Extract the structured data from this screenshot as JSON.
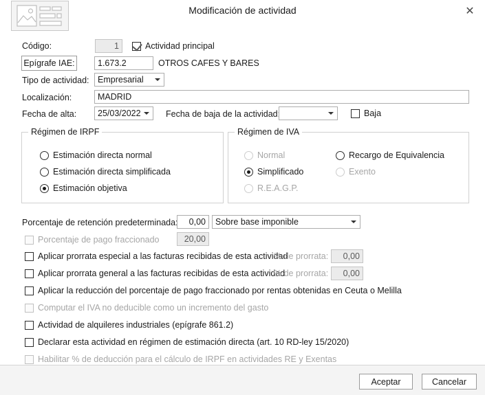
{
  "window": {
    "title": "Modificación de actividad",
    "close_label": "✕",
    "icon_name": "image-form-icon"
  },
  "form": {
    "codigo_label": "Código:",
    "codigo_value": "1",
    "actividad_principal_label": "Actividad principal",
    "actividad_principal_checked": true,
    "epigrafe_button_label": "Epígrafe IAE:",
    "epigrafe_value": "1.673.2",
    "epigrafe_description": "OTROS CAFES Y BARES",
    "tipo_actividad_label": "Tipo de actividad:",
    "tipo_actividad_value": "Empresarial",
    "localizacion_label": "Localización:",
    "localizacion_value": "MADRID",
    "fecha_alta_label": "Fecha de alta:",
    "fecha_alta_value": "25/03/2022",
    "fecha_baja_label": "Fecha de baja de la actividad:",
    "fecha_baja_value": "",
    "baja_label": "Baja",
    "baja_checked": false
  },
  "irpf": {
    "title": "Régimen de IRPF",
    "options": [
      {
        "label": "Estimación directa normal",
        "selected": false,
        "disabled": false
      },
      {
        "label": "Estimación directa simplificada",
        "selected": false,
        "disabled": false
      },
      {
        "label": "Estimación objetiva",
        "selected": true,
        "disabled": false
      }
    ]
  },
  "iva": {
    "title": "Régimen de IVA",
    "options_left": [
      {
        "label": "Normal",
        "selected": false,
        "disabled": true
      },
      {
        "label": "Simplificado",
        "selected": true,
        "disabled": false
      },
      {
        "label": "R.E.A.G.P.",
        "selected": false,
        "disabled": true
      }
    ],
    "options_right": [
      {
        "label": "Recargo de Equivalencia",
        "selected": false,
        "disabled": false
      },
      {
        "label": "Exento",
        "selected": false,
        "disabled": true
      }
    ]
  },
  "percentages": {
    "retencion_label": "Porcentaje de retención predeterminada:",
    "retencion_value": "0,00",
    "retencion_base_value": "Sobre base imponible",
    "pago_fraccionado_label": "Porcentaje de pago fraccionado",
    "pago_fraccionado_checked": false,
    "pago_fraccionado_disabled": true,
    "pago_fraccionado_value": "20,00"
  },
  "options": [
    {
      "label": "Aplicar prorrata especial a las facturas recibidas de esta actividad",
      "checked": false,
      "disabled": false,
      "extra_label": "% de prorrata:",
      "extra_value": "0,00"
    },
    {
      "label": "Aplicar prorrata general a las facturas recibidas de esta actividad",
      "checked": false,
      "disabled": false,
      "extra_label": "% de prorrata:",
      "extra_value": "0,00"
    },
    {
      "label": "Aplicar la reducción del porcentaje de pago fraccionado por rentas obtenidas en Ceuta o Melilla",
      "checked": false,
      "disabled": false
    },
    {
      "label": "Computar el IVA no deducible como un incremento del gasto",
      "checked": false,
      "disabled": true
    },
    {
      "label": "Actividad de alquileres industriales (epígrafe 861.2)",
      "checked": false,
      "disabled": false
    },
    {
      "label": "Declarar esta actividad en régimen de estimación directa (art. 10 RD-ley 15/2020)",
      "checked": false,
      "disabled": false
    },
    {
      "label": "Habilitar % de deducción para el cálculo de IRPF en actividades RE y Exentas",
      "checked": false,
      "disabled": true
    }
  ],
  "footer": {
    "accept_label": "Aceptar",
    "cancel_label": "Cancelar"
  },
  "colors": {
    "dialog_bg": "#ffffff",
    "footer_bg": "#f4f4f4",
    "border": "#adadad",
    "disabled_text": "#a6a6a6",
    "readonly_bg": "#ebebeb"
  }
}
